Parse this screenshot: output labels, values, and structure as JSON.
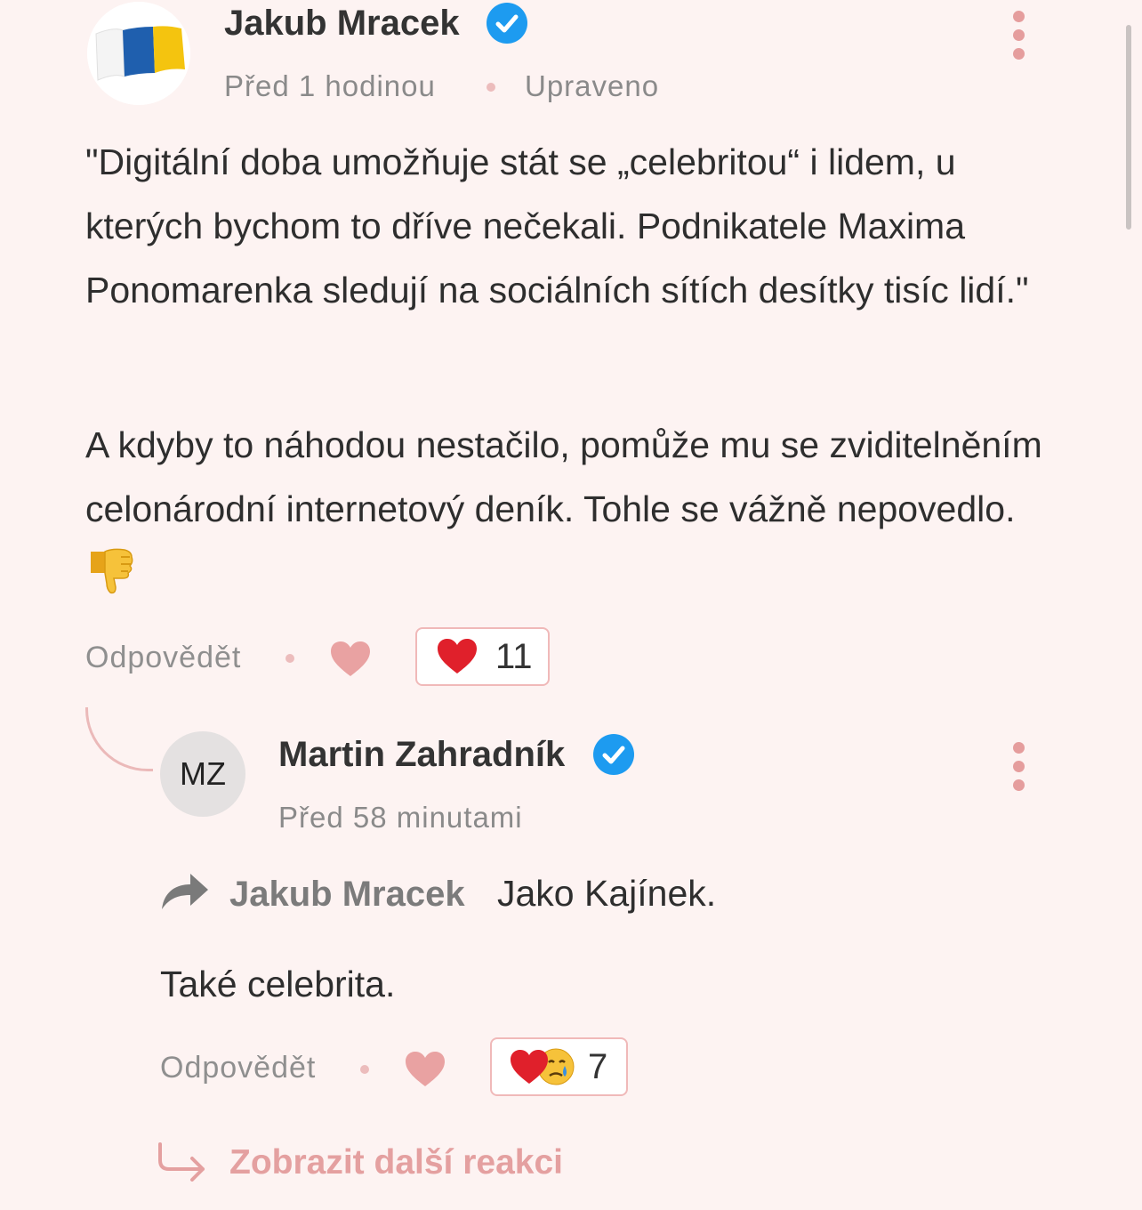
{
  "comment": {
    "author": "Jakub Mracek",
    "time": "Před 1 hodinou",
    "edited": "Upraveno",
    "paragraphs": [
      "\"Digitální doba umožňuje stát se „celebritou“ i lidem, u kterých bychom to dříve nečekali. Podnikatele Maxima Ponomarenka sledují na sociálních sítích desítky tisíc lidí.\"",
      "A kdyby to náhodou nestačilo, pomůže mu se zviditelněním celonárodní internetový deník. Tohle se vážně nepovedlo."
    ],
    "emoji": "👎",
    "reply_label": "Odpovědět",
    "reaction_count": "11"
  },
  "reply": {
    "initials": "MZ",
    "author": "Martin Zahradník",
    "time": "Před 58 minutami",
    "reply_to": "Jakub Mracek",
    "text1": "Jako Kajínek.",
    "text2": "Také celebrita.",
    "reply_label": "Odpovědět",
    "reaction_count": "7"
  },
  "more_reactions": "Zobrazit další reakci",
  "colors": {
    "background": "#fdf3f2",
    "accent": "#e59d9d",
    "verified": "#1d9bf0",
    "heart": "#e23b3b"
  },
  "icons": {
    "verified": "verified-badge-icon",
    "kebab": "more-vertical-icon",
    "like": "heart-icon",
    "share_arrow": "reply-arrow-icon",
    "more": "corner-down-right-icon"
  }
}
